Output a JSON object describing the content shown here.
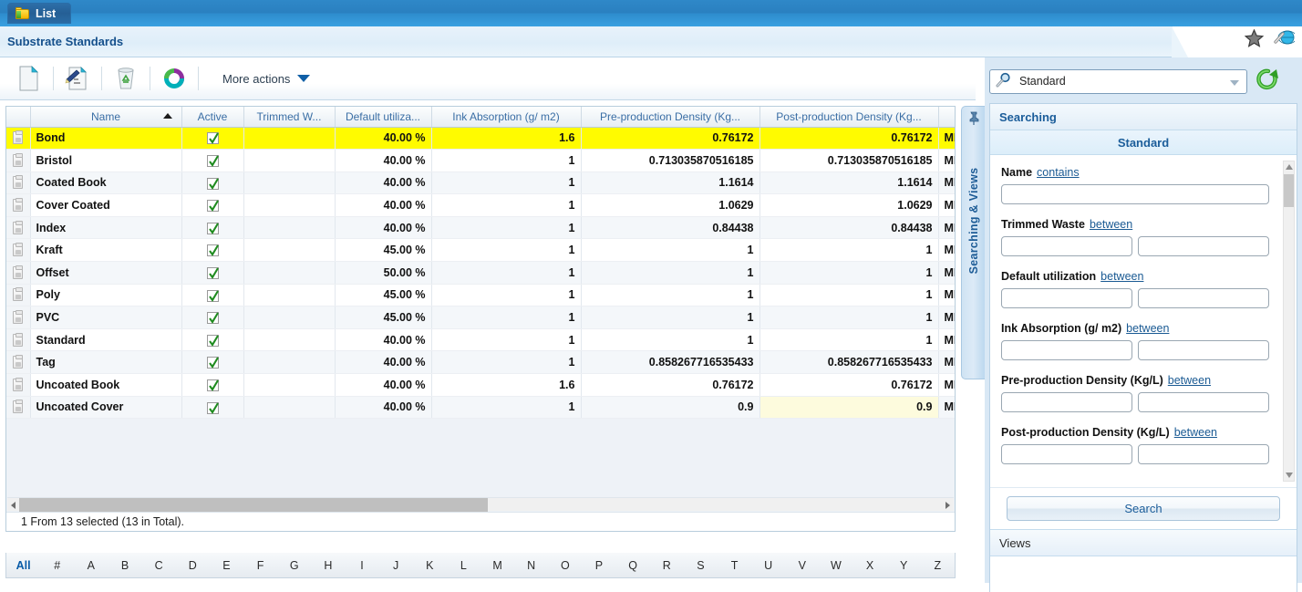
{
  "window": {
    "tab_label": "List",
    "tab_icon": "folder-icon",
    "page_title": "Substrate Standards",
    "favorite_icon": "star-icon",
    "link_icon": "globe-icon"
  },
  "toolbar": {
    "buttons": [
      {
        "name": "new-record-button",
        "icon": "new-document-icon"
      },
      {
        "name": "edit-record-button",
        "icon": "edit-document-icon"
      },
      {
        "name": "delete-record-button",
        "icon": "trash-icon"
      },
      {
        "name": "refresh-button",
        "icon": "refresh-circle-icon"
      }
    ],
    "more_actions_label": "More actions",
    "more_actions_icon": "chevron-down-icon"
  },
  "grid": {
    "columns": [
      {
        "key": "sel",
        "label": ""
      },
      {
        "key": "name",
        "label": "Name",
        "sorted": "asc"
      },
      {
        "key": "active",
        "label": "Active"
      },
      {
        "key": "trim",
        "label": "Trimmed W..."
      },
      {
        "key": "def",
        "label": "Default utiliza..."
      },
      {
        "key": "ink",
        "label": "Ink Absorption (g/ m2)"
      },
      {
        "key": "pre",
        "label": "Pre-production Density (Kg..."
      },
      {
        "key": "post",
        "label": "Post-production Density (Kg..."
      },
      {
        "key": "me",
        "label": ""
      }
    ],
    "rows": [
      {
        "name": "Bond",
        "active": true,
        "trim": "",
        "def": "40.00 %",
        "ink": "1.6",
        "pre": "0.76172",
        "post": "0.76172",
        "me": "ME",
        "selected": true,
        "post_hl": false
      },
      {
        "name": "Bristol",
        "active": true,
        "trim": "",
        "def": "40.00 %",
        "ink": "1",
        "pre": "0.713035870516185",
        "post": "0.713035870516185",
        "me": "ME",
        "selected": false,
        "post_hl": false
      },
      {
        "name": "Coated Book",
        "active": true,
        "trim": "",
        "def": "40.00 %",
        "ink": "1",
        "pre": "1.1614",
        "post": "1.1614",
        "me": "ME",
        "selected": false,
        "post_hl": false
      },
      {
        "name": "Cover Coated",
        "active": true,
        "trim": "",
        "def": "40.00 %",
        "ink": "1",
        "pre": "1.0629",
        "post": "1.0629",
        "me": "ME",
        "selected": false,
        "post_hl": false
      },
      {
        "name": "Index",
        "active": true,
        "trim": "",
        "def": "40.00 %",
        "ink": "1",
        "pre": "0.84438",
        "post": "0.84438",
        "me": "ME",
        "selected": false,
        "post_hl": false
      },
      {
        "name": "Kraft",
        "active": true,
        "trim": "",
        "def": "45.00 %",
        "ink": "1",
        "pre": "1",
        "post": "1",
        "me": "ME",
        "selected": false,
        "post_hl": false
      },
      {
        "name": "Offset",
        "active": true,
        "trim": "",
        "def": "50.00 %",
        "ink": "1",
        "pre": "1",
        "post": "1",
        "me": "ME",
        "selected": false,
        "post_hl": false
      },
      {
        "name": "Poly",
        "active": true,
        "trim": "",
        "def": "45.00 %",
        "ink": "1",
        "pre": "1",
        "post": "1",
        "me": "ME",
        "selected": false,
        "post_hl": false
      },
      {
        "name": "PVC",
        "active": true,
        "trim": "",
        "def": "45.00 %",
        "ink": "1",
        "pre": "1",
        "post": "1",
        "me": "ME",
        "selected": false,
        "post_hl": false
      },
      {
        "name": "Standard",
        "active": true,
        "trim": "",
        "def": "40.00 %",
        "ink": "1",
        "pre": "1",
        "post": "1",
        "me": "ME",
        "selected": false,
        "post_hl": false
      },
      {
        "name": "Tag",
        "active": true,
        "trim": "",
        "def": "40.00 %",
        "ink": "1",
        "pre": "0.858267716535433",
        "post": "0.858267716535433",
        "me": "ME",
        "selected": false,
        "post_hl": false
      },
      {
        "name": "Uncoated Book",
        "active": true,
        "trim": "",
        "def": "40.00 %",
        "ink": "1.6",
        "pre": "0.76172",
        "post": "0.76172",
        "me": "ME",
        "selected": false,
        "post_hl": false
      },
      {
        "name": "Uncoated Cover",
        "active": true,
        "trim": "",
        "def": "40.00 %",
        "ink": "1",
        "pre": "0.9",
        "post": "0.9",
        "me": "ME",
        "selected": false,
        "post_hl": true
      }
    ],
    "status_text": "1 From 13 selected (13 in Total)."
  },
  "alphabet": [
    "All",
    "#",
    "A",
    "B",
    "C",
    "D",
    "E",
    "F",
    "G",
    "H",
    "I",
    "J",
    "K",
    "L",
    "M",
    "N",
    "O",
    "P",
    "Q",
    "R",
    "S",
    "T",
    "U",
    "V",
    "W",
    "X",
    "Y",
    "Z"
  ],
  "side_tab": {
    "label": "Searching & Views",
    "pin_icon": "pin-icon"
  },
  "right_panel": {
    "search_select": {
      "value": "Standard",
      "icon": "magnifier-icon",
      "dropdown_icon": "chevron-down-icon"
    },
    "refresh_icon": "refresh-arrow-icon",
    "header": "Searching",
    "subheader": "Standard",
    "fields": [
      {
        "label": "Name",
        "operator": "contains",
        "inputs": 1,
        "value1": "",
        "value2": ""
      },
      {
        "label": "Trimmed Waste",
        "operator": "between",
        "inputs": 2,
        "value1": "",
        "value2": ""
      },
      {
        "label": "Default utilization",
        "operator": "between",
        "inputs": 2,
        "value1": "",
        "value2": ""
      },
      {
        "label": "Ink Absorption (g/ m2)",
        "operator": "between",
        "inputs": 2,
        "value1": "",
        "value2": ""
      },
      {
        "label": "Pre-production Density (Kg/L)",
        "operator": "between",
        "inputs": 2,
        "value1": "",
        "value2": ""
      },
      {
        "label": "Post-production Density (Kg/L)",
        "operator": "between",
        "inputs": 2,
        "value1": "",
        "value2": ""
      }
    ],
    "search_button": "Search",
    "views_header": "Views"
  },
  "colors": {
    "topbar_blue": "#2a80c0",
    "selected_row": "#fffb00",
    "accent_link": "#1a5a93",
    "header_text": "#3a6ea5",
    "panel_title": "#1b5d9a"
  }
}
